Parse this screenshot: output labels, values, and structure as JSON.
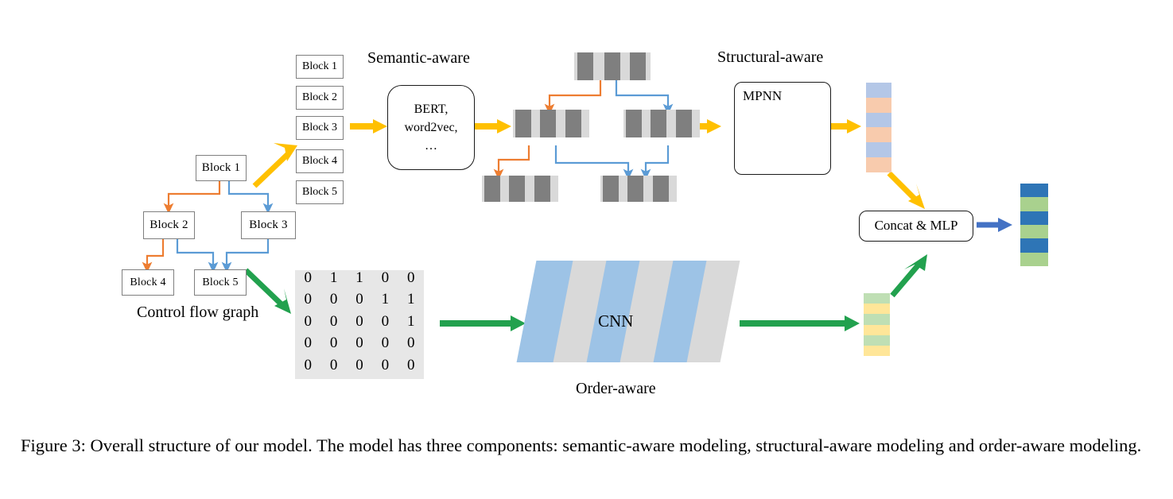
{
  "figure": {
    "caption": "Figure 3: Overall structure of our model. The model has three components: semantic-aware modeling, structural-aware modeling and order-aware modeling."
  },
  "colors": {
    "orange_edge": "#ED7D31",
    "blue_edge": "#5B9BD5",
    "yellow_arrow": "#FFC000",
    "green_arrow": "#22A14E",
    "blue_arrow": "#4472C4",
    "node_blue": "#2E75B6",
    "msg_blue": "#9DC3E6",
    "bar_bg": "#D9D9D9",
    "bar_fg": "#7F7F7F",
    "vec_blue_light": "#B4C7E7",
    "vec_peach": "#F8CBAD",
    "vec_green_light": "#BFDFB4",
    "vec_yellow": "#FFE699",
    "vec_blue_strong": "#2E75B6",
    "vec_green": "#A9D18E",
    "matrix_bg": "#E7E7E7",
    "plane_blue": "#9DC3E6",
    "plane_gray": "#D9D9D9",
    "box_border": "#7F7F7F"
  },
  "cfg": {
    "title": "Control flow graph",
    "nodes": [
      {
        "id": "b1",
        "label": "Block 1"
      },
      {
        "id": "b2",
        "label": "Block 2"
      },
      {
        "id": "b3",
        "label": "Block 3"
      },
      {
        "id": "b4",
        "label": "Block 4"
      },
      {
        "id": "b5",
        "label": "Block 5"
      }
    ],
    "edges": [
      {
        "from": "b1",
        "to": "b2",
        "color": "orange"
      },
      {
        "from": "b1",
        "to": "b3",
        "color": "blue"
      },
      {
        "from": "b2",
        "to": "b4",
        "color": "orange"
      },
      {
        "from": "b2",
        "to": "b5",
        "color": "blue"
      },
      {
        "from": "b3",
        "to": "b5",
        "color": "blue"
      }
    ]
  },
  "block_list": {
    "items": [
      "Block 1",
      "Block 2",
      "Block 3",
      "Block 4",
      "Block 5"
    ]
  },
  "semantic": {
    "section_label": "Semantic-aware",
    "encoder_box": "BERT,\nword2vec,\n…",
    "encoder_lines": [
      "BERT,",
      "word2vec,",
      "…"
    ],
    "embeddings": [
      {
        "id": "e1",
        "segments": 3
      },
      {
        "id": "e2",
        "segments": 3
      },
      {
        "id": "e3",
        "segments": 3
      },
      {
        "id": "e4",
        "segments": 3
      },
      {
        "id": "e5",
        "segments": 3
      }
    ]
  },
  "structural": {
    "section_label": "Structural-aware",
    "module_label": "MPNN",
    "graph_nodes": 5,
    "output_vector": {
      "cells": [
        "#B4C7E7",
        "#F8CBAD",
        "#B4C7E7",
        "#F8CBAD",
        "#B4C7E7",
        "#F8CBAD"
      ]
    }
  },
  "order": {
    "section_label": "Order-aware",
    "module_label": "CNN",
    "plane_count": 6,
    "output_vector": {
      "cells": [
        "#BFDFB4",
        "#FFE699",
        "#BFDFB4",
        "#FFE699",
        "#BFDFB4",
        "#FFE699"
      ]
    }
  },
  "matrix": {
    "name": "adjacency-matrix",
    "rows": [
      [
        "0",
        "1",
        "1",
        "0",
        "0"
      ],
      [
        "0",
        "0",
        "0",
        "1",
        "1"
      ],
      [
        "0",
        "0",
        "0",
        "0",
        "1"
      ],
      [
        "0",
        "0",
        "0",
        "0",
        "0"
      ],
      [
        "0",
        "0",
        "0",
        "0",
        "0"
      ]
    ]
  },
  "fusion": {
    "label": "Concat & MLP",
    "output_vector": {
      "cells": [
        "#2E75B6",
        "#A9D18E",
        "#2E75B6",
        "#A9D18E",
        "#2E75B6",
        "#A9D18E"
      ]
    }
  },
  "chart_data": {
    "type": "diagram",
    "title": "Overall structure of our model",
    "nodes": [
      "Control flow graph",
      "Block list",
      "BERT, word2vec, …",
      "MPNN",
      "CNN",
      "Concat & MLP"
    ],
    "branches": [
      "semantic-aware",
      "structural-aware",
      "order-aware"
    ]
  }
}
